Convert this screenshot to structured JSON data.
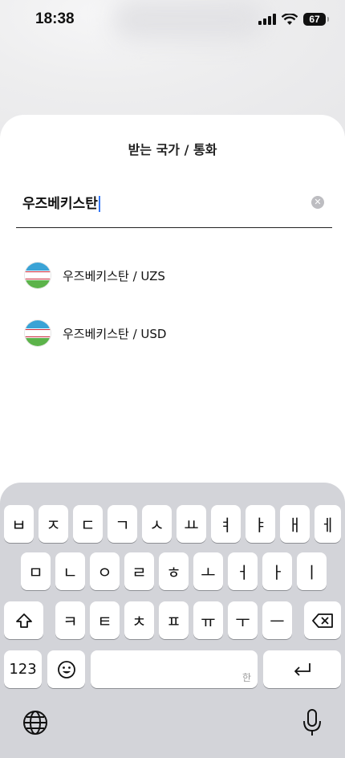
{
  "status_bar": {
    "time": "18:38",
    "battery": "67"
  },
  "sheet": {
    "title": "받는 국가 / 통화",
    "search": {
      "value": "우즈베키스탄"
    },
    "results": [
      {
        "label": "우즈베키스탄 / UZS",
        "flag_icon": "uzbekistan-flag-icon"
      },
      {
        "label": "우즈베키스탄 / USD",
        "flag_icon": "uzbekistan-flag-icon"
      }
    ]
  },
  "keyboard": {
    "row1": [
      "ㅂ",
      "ㅈ",
      "ㄷ",
      "ㄱ",
      "ㅅ",
      "ㅛ",
      "ㅕ",
      "ㅑ",
      "ㅐ",
      "ㅔ"
    ],
    "row2": [
      "ㅁ",
      "ㄴ",
      "ㅇ",
      "ㄹ",
      "ㅎ",
      "ㅗ",
      "ㅓ",
      "ㅏ",
      "ㅣ"
    ],
    "row3": [
      "ㅋ",
      "ㅌ",
      "ㅊ",
      "ㅍ",
      "ㅠ",
      "ㅜ",
      "ㅡ"
    ],
    "numbers_label": "123",
    "space_hint": "한"
  },
  "colors": {
    "accent": "#3478f6",
    "keyboard_bg": "#d3d4d9"
  }
}
